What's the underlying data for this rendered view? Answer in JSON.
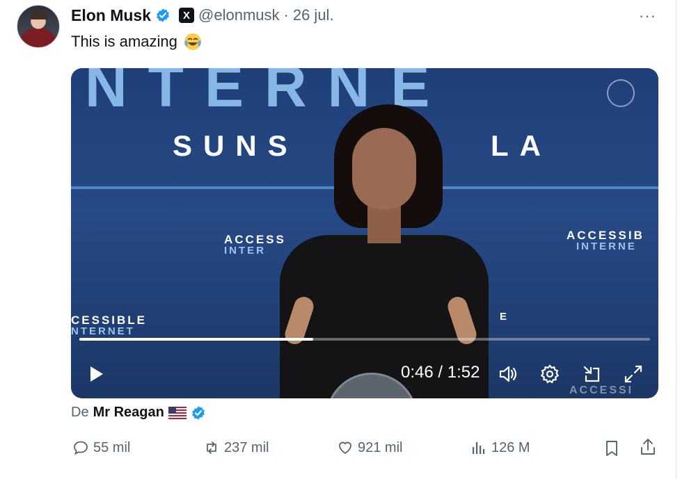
{
  "tweet": {
    "author_name": "Elon Musk",
    "handle": "@elonmusk",
    "separator": "·",
    "date": "26 jul.",
    "text": "This is amazing",
    "emoji_icon": "face-with-tears-of-joy-emoji",
    "more_label": "···"
  },
  "video": {
    "stage_text": {
      "big": "NTERNE",
      "suns": "SUNS",
      "la": "LA",
      "acc_center": "ACCESS",
      "acc_center_sub": "INTER",
      "acc_right": "ACCESSIB",
      "acc_right_sub": "INTERNE",
      "acc_left": "CESSIBLE",
      "acc_left_sub": "NTERNET",
      "acc_small": "E",
      "acc_bottom": "ACCESSI"
    },
    "current_time": "0:46",
    "time_separator": " / ",
    "duration": "1:52",
    "progress_fraction": 0.41
  },
  "source": {
    "prefix": "De",
    "user": "Mr Reagan",
    "flag_icon": "us-flag-emoji"
  },
  "actions": {
    "replies": "55 mil",
    "reposts": "237 mil",
    "likes": "921 mil",
    "views": "126 M"
  },
  "colors": {
    "verified_blue": "#1d9bf0",
    "text_secondary": "#536471",
    "text_primary": "#0f1419"
  }
}
